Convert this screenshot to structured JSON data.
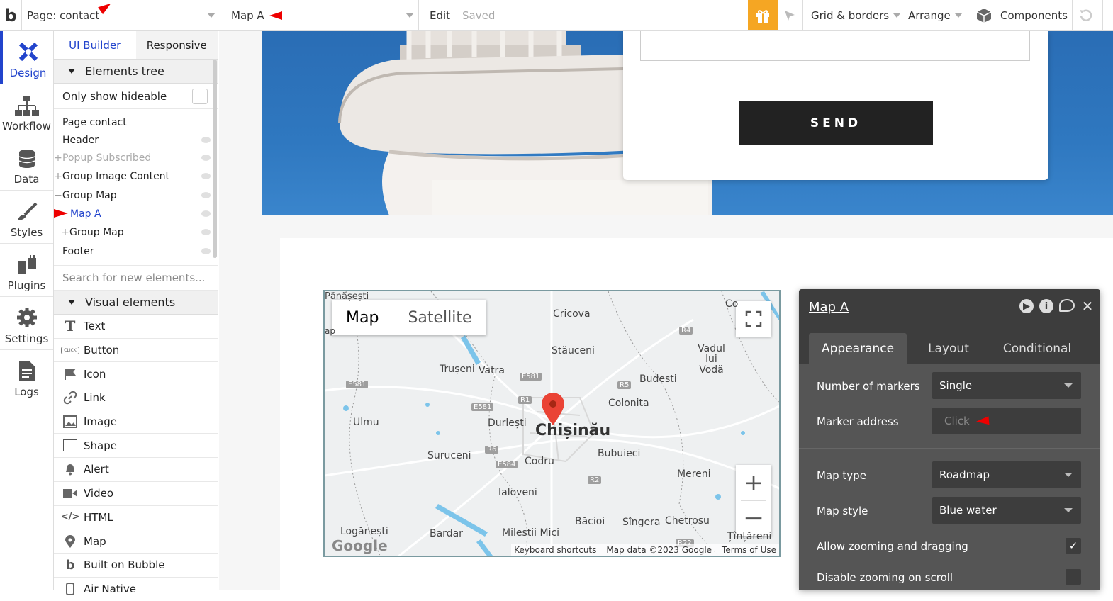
{
  "topbar": {
    "logo": "b",
    "page_select": "Page: contact",
    "element_select": "Map A",
    "edit": "Edit",
    "saved": "Saved",
    "grid": "Grid & borders",
    "arrange": "Arrange",
    "components": "Components"
  },
  "left_nav": [
    {
      "label": "Design",
      "icon": "design-icon"
    },
    {
      "label": "Workflow",
      "icon": "workflow-icon"
    },
    {
      "label": "Data",
      "icon": "database-icon"
    },
    {
      "label": "Styles",
      "icon": "brush-icon"
    },
    {
      "label": "Plugins",
      "icon": "plug-icon"
    },
    {
      "label": "Settings",
      "icon": "gear-icon"
    },
    {
      "label": "Logs",
      "icon": "document-icon"
    }
  ],
  "panel": {
    "tab_ui_builder": "UI Builder",
    "tab_responsive": "Responsive",
    "elements_tree": "Elements tree",
    "only_show_hideable": "Only show hideable",
    "tree": [
      {
        "label": "Page contact",
        "prefix": ""
      },
      {
        "label": "Header",
        "prefix": ""
      },
      {
        "label": "Popup Subscribed",
        "prefix": "+"
      },
      {
        "label": "Group Image Content",
        "prefix": "+"
      },
      {
        "label": "Group Map",
        "prefix": "−"
      },
      {
        "label": "Map A",
        "prefix": ""
      },
      {
        "label": "Group Map",
        "prefix": "+"
      },
      {
        "label": "Footer",
        "prefix": ""
      }
    ],
    "search_placeholder": "Search for new elements...",
    "visual_elements": "Visual elements",
    "elements": [
      "Text",
      "Button",
      "Icon",
      "Link",
      "Image",
      "Shape",
      "Alert",
      "Video",
      "HTML",
      "Map",
      "Built on Bubble",
      "Air Native"
    ],
    "button_icon_text": "CLICK"
  },
  "canvas": {
    "send_button": "SEND"
  },
  "map": {
    "type_map": "Map",
    "type_satellite": "Satellite",
    "city": "Chișinău",
    "labels": [
      "Pănășești",
      "Cricova",
      "Stăuceni",
      "Trușeni",
      "Vatra",
      "Vadul lui Vodă",
      "Budesti",
      "Colonita",
      "Ulmu",
      "Durlești",
      "Bubuieci",
      "Sîngera",
      "Suruceni",
      "Codru",
      "Mereni",
      "Ialoveni",
      "Băcioi",
      "Chetrosu",
      "Bardar",
      "Milestii Mici",
      "Logănești",
      "Țînțăreni",
      "Co",
      "ap"
    ],
    "badges": [
      "R4",
      "E581",
      "E581",
      "E581",
      "R1",
      "R5",
      "R6",
      "E584",
      "R2",
      "R22"
    ],
    "google": "Google",
    "keyboard": "Keyboard shortcuts",
    "mapdata": "Map data ©2023 Google",
    "terms": "Terms of Use"
  },
  "properties": {
    "title": "Map A",
    "tabs": [
      "Appearance",
      "Layout",
      "Conditional"
    ],
    "number_of_markers_label": "Number of markers",
    "number_of_markers_value": "Single",
    "marker_address_label": "Marker address",
    "marker_address_value": "Click",
    "map_type_label": "Map type",
    "map_type_value": "Roadmap",
    "map_style_label": "Map style",
    "map_style_value": "Blue water",
    "allow_zoom_label": "Allow zooming and dragging",
    "allow_zoom_checked": true,
    "disable_scroll_label": "Disable zooming on scroll",
    "disable_scroll_checked": false
  }
}
